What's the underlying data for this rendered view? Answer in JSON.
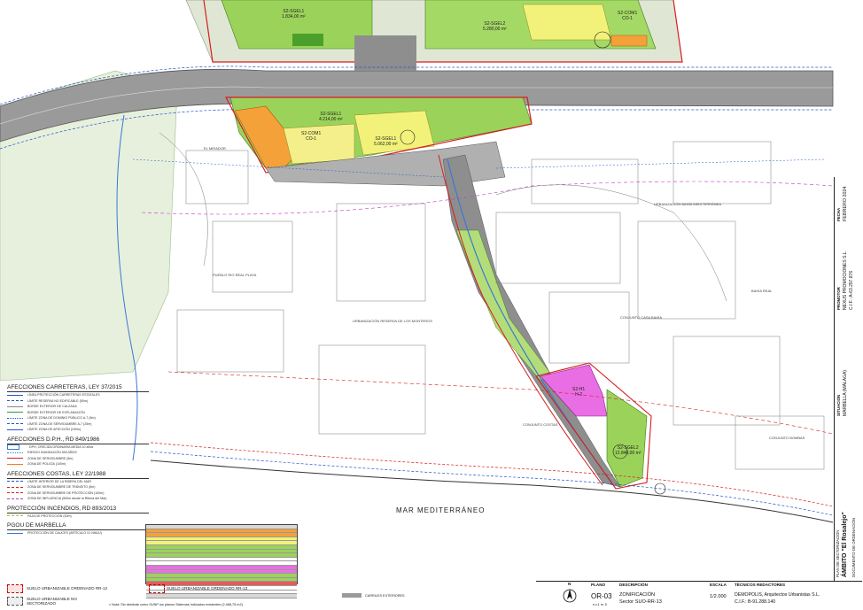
{
  "plan": {
    "sea_label": "MAR MEDITERRÁNEO",
    "place_labels": [
      "EL MIRADOR",
      "PUEBLO RIO REAL PLAYA",
      "URBANIZACIÓN RESERVA DE LOS MONTEROS",
      "URBANIZACIÓN BAHÍA MEDITERRÁNEA",
      "BAHÍA REAL",
      "CONJUNTO CASA BAHÍA",
      "CONJUNTO COSTAS",
      "CONJUNTO BOMBAS"
    ],
    "zones": [
      {
        "code": "S2-SGEL1",
        "detail": "1.834,00 m²"
      },
      {
        "code": "S2-COM1",
        "detail": "CO-1"
      },
      {
        "code": "S2-SGEL1",
        "detail": "4.214,00 m²"
      },
      {
        "code": "S2-SGEL2",
        "detail": "5.280,00 m²"
      },
      {
        "code": "S2-COM1",
        "detail": "CO-1"
      },
      {
        "code": "S2-SGEL1",
        "detail": "5.062,00 m²"
      },
      {
        "code": "S2-H1",
        "detail": "H-2"
      },
      {
        "code": "S2-SGEL2",
        "detail": "12.840,00 m²"
      }
    ],
    "colors": {
      "green": "#9bd35a",
      "yellow": "#f2f27a",
      "orange": "#f5a13a",
      "magenta": "#e96ee3",
      "grey_road": "#8e8e8e",
      "blue_water": "#3a78d6",
      "red_boundary": "#d61e1e"
    }
  },
  "legend": {
    "sections": [
      {
        "title": "AFECCIONES CARRETERAS, LEY 37/2015",
        "items": [
          {
            "label": "LÍNEA PROTECCIÓN CARRETERAS ESTATALES",
            "color": "#2255cc",
            "style": "solid"
          },
          {
            "label": "LÍMITE RESERVA NO EDIFICABLE (50m)",
            "color": "#2255cc",
            "style": "dashed"
          },
          {
            "label": "BORDE EXTERIOR DE CALZADA",
            "color": "#888888",
            "style": "solid"
          },
          {
            "label": "BORDE EXTERIOR DE EXPLANACIÓN",
            "color": "#2a9a3a",
            "style": "solid"
          },
          {
            "label": "LÍMITE ZONA DE DOMINIO PÚBLICO A-7 (8m)",
            "color": "#2255cc",
            "style": "dotted"
          },
          {
            "label": "LÍMITE ZONA DE SERVIDUMBRE A-7 (25m)",
            "color": "#2255cc",
            "style": "dashed"
          },
          {
            "label": "LÍMITE ZONA DE AFECCIÓN (100m)",
            "color": "#2255cc",
            "style": "solid"
          }
        ]
      },
      {
        "title": "AFECCIONES D.P.H., RD 849/1986",
        "items": [
          {
            "label": "DPH, CRECIDA ORDINARIA MEDIA 10 años",
            "color": "#3a78d6",
            "style": "box"
          },
          {
            "label": "RIESGO INUNDACIÓN 500 AÑOS",
            "color": "#3a78d6",
            "style": "dotted"
          },
          {
            "label": "ZONA DE SERVIDUMBRE (5m)",
            "color": "#d61e1e",
            "style": "solid"
          },
          {
            "label": "ZONA DE POLICÍA (100m)",
            "color": "#f07a2a",
            "style": "solid"
          }
        ]
      },
      {
        "title": "AFECCIONES COSTAS, LEY 22/1988",
        "items": [
          {
            "label": "LÍMITE INTERIOR DE LA RIBERA DEL MAR",
            "color": "#2255cc",
            "style": "dashed"
          },
          {
            "label": "ZONA DE SERVIDUMBRE DE TRÁNSITO (6m)",
            "color": "#d61e1e",
            "style": "dashed"
          },
          {
            "label": "ZONA DE SERVIDUMBRE DE PROTECCIÓN (100m)",
            "color": "#d61e1e",
            "style": "dashed"
          },
          {
            "label": "ZONA DE INFLUENCIA (500m desde la Ribera del Mar)",
            "color": "#c03cc0",
            "style": "dashed"
          }
        ]
      },
      {
        "title": "PROTECCIÓN INCENDIOS, RD 893/2013",
        "items": [
          {
            "label": "FAJA DE PROTECCIÓN (30m)",
            "color": "#9bcf2a",
            "style": "dashed"
          }
        ]
      },
      {
        "title": "PGOU DE MARBELLA",
        "items": [
          {
            "label": "PROTECCIÓN DE CAUCES (ARTÍCULO 01 NNUU)",
            "color": "#3a78d6",
            "style": "solid"
          }
        ]
      }
    ]
  },
  "bottom_legend": {
    "item1": "SUELO URBANIZABLE ORDENADO RR-12",
    "item2": "SUELO URBANIZABLE ORDENADO RR-13",
    "item3": "SUELO URBANIZABLE NO SECTORIZADO",
    "note": "» Nota: Sin deslinde como SUNP los planos Sistemas Indicados existentes (2.468,75 m2)",
    "carriles": "CARRILES EXTERIORES"
  },
  "cartouche": {
    "north": "N",
    "plano_head": "PLANO",
    "plano_val": "OR-03",
    "plano_sub": "e.c.1 m. 5",
    "desc_head": "DESCRIPCIÓN",
    "desc_line1": "ZONIFICACIÓN",
    "desc_line2": "Sector SUO-RR-13",
    "escala_head": "ESCALA",
    "escala_val": "1/2.000",
    "tec_head": "TÉCNICOS REDACTORES",
    "tec_line1": "DEMOPOLIS, Arquitectos Urbanistas S.L.",
    "tec_line2": "C.I.F.: B-91.288.140"
  },
  "side_panel": {
    "fecha_head": "FECHA",
    "fecha_val": "FEBRERO 2024",
    "prop_head": "PROMOTOR",
    "prop_val1": "NEXUS PROMOCIONES S.L.",
    "prop_val2": "C.I.F.: A-63.297.876",
    "sit_head": "SITUACIÓN",
    "sit_val": "MARBELLA (MÁLAGA)",
    "title1": "PLAN DE SECTORIZACIÓN",
    "title2": "ÁMBITO \"El Rosalejo\"",
    "title3": "DOCUMENTO DE ORDENACIÓN"
  }
}
